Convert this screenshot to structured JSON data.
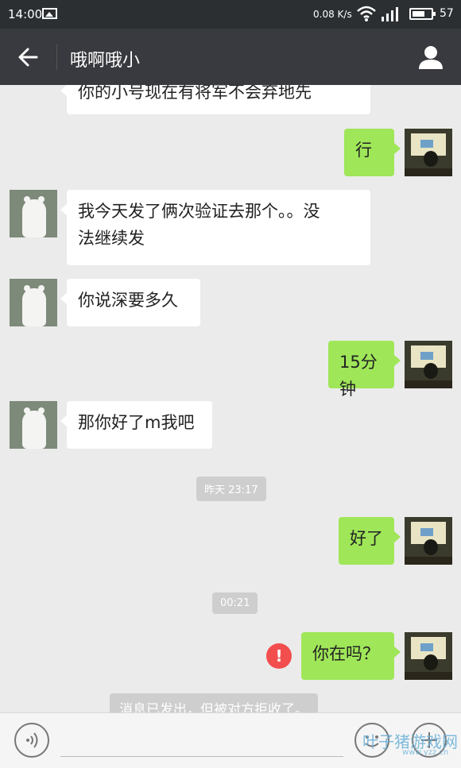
{
  "status_bar": {
    "time": "14:00",
    "net_speed": "0.08 K/s",
    "battery": "57"
  },
  "title_bar": {
    "title": "哦啊哦小"
  },
  "messages": [
    {
      "side": "left",
      "text": "你的小号现在有将军不会弃地先"
    },
    {
      "side": "right",
      "text": "行"
    },
    {
      "side": "left",
      "text_line1": "我今天发了俩次验证去那个。。没",
      "text_line2": "法继续发"
    },
    {
      "side": "left",
      "text": "你说深要多久"
    },
    {
      "side": "right",
      "text": "15分钟"
    },
    {
      "side": "left",
      "text": "那你好了m我吧"
    },
    {
      "type": "time",
      "text": "昨天 23:17"
    },
    {
      "side": "right",
      "text": "好了"
    },
    {
      "type": "time",
      "text": "00:21"
    },
    {
      "side": "right",
      "text": "你在吗？",
      "failed": true
    },
    {
      "type": "system",
      "text": "消息已发出，但被对方拒收了。"
    }
  ],
  "error_glyph": "!",
  "input_bar": {
    "voice_icon": "voice-icon",
    "emoji_icon": "emoji-icon",
    "more_icon": "plus-icon"
  },
  "watermark": {
    "text": "叶子猪游戏网",
    "url": "www.yzz.cn"
  },
  "colors": {
    "status_bar": "#2b2f32",
    "title_bar": "#393a3f",
    "chat_bg": "#ebebeb",
    "bubble_self": "#9fe658",
    "bubble_other": "#ffffff",
    "error": "#f24e4e"
  }
}
